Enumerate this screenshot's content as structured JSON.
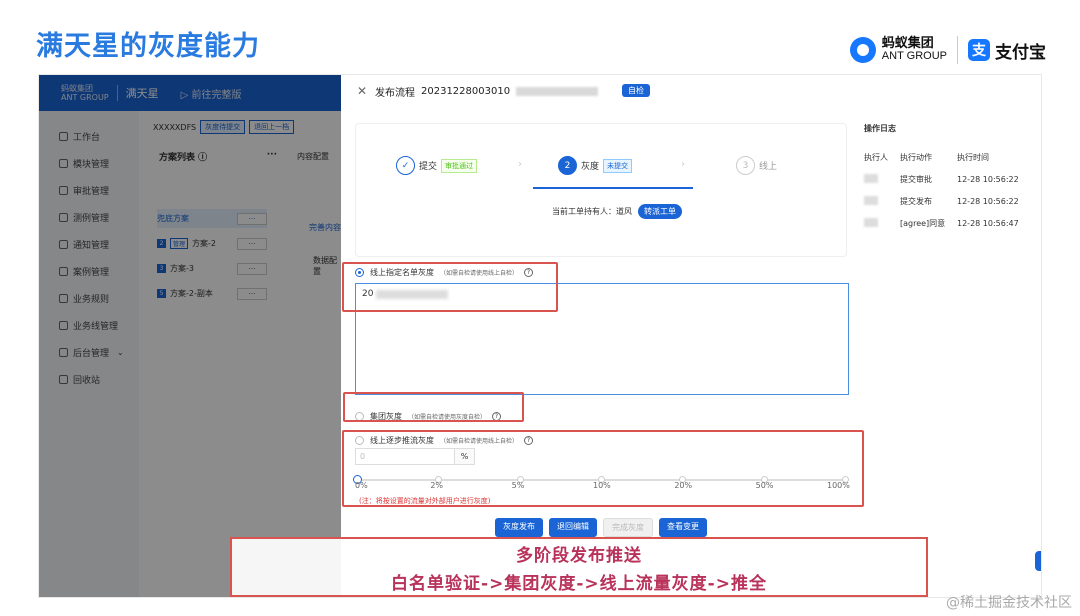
{
  "slide": {
    "title": "满天星的灰度能力",
    "logos": {
      "ant_cn": "蚂蚁集团",
      "ant_en": "ANT GROUP",
      "alipay": "支付宝",
      "alipay_mark": "支"
    }
  },
  "app": {
    "brand_cn": "蚂蚁集团",
    "brand_en": "ANT GROUP",
    "name": "满天星",
    "goto_full": "前往完整版",
    "sidebar": [
      {
        "label": "工作台",
        "icon": "home-icon"
      },
      {
        "label": "模块管理",
        "icon": "module-icon"
      },
      {
        "label": "审批管理",
        "icon": "approval-icon"
      },
      {
        "label": "测例管理",
        "icon": "test-icon"
      },
      {
        "label": "通知管理",
        "icon": "notify-icon"
      },
      {
        "label": "案例管理",
        "icon": "case-icon"
      },
      {
        "label": "业务规则",
        "icon": "rule-icon"
      },
      {
        "label": "业务线管理",
        "icon": "line-icon"
      },
      {
        "label": "后台管理",
        "icon": "admin-icon",
        "expandable": true
      },
      {
        "label": "回收站",
        "icon": "trash-icon"
      }
    ],
    "mid": {
      "code": "XXXXXDFS",
      "status_btn": "灰度待提交",
      "back_btn": "退回上一档",
      "plan_list_title": "方案列表",
      "more": "···",
      "content_config": "内容配置",
      "plans": [
        {
          "name": "兜底方案",
          "tag": "",
          "btn": "···"
        },
        {
          "name": "方案-2",
          "tag": "2",
          "prefix": "管理",
          "btn": "···"
        },
        {
          "name": "方案-3",
          "tag": "3",
          "btn": "···"
        },
        {
          "name": "方案-2-副本",
          "tag": "5",
          "btn": "···"
        }
      ],
      "link": "完善内容",
      "data_config": "数据配置"
    }
  },
  "drawer": {
    "title_prefix": "发布流程",
    "flow_id": "20231228003010",
    "badge": "自检",
    "steps": [
      {
        "num": "✓",
        "label": "提交",
        "tag": "审批通过",
        "state": "done"
      },
      {
        "num": "2",
        "label": "灰度",
        "tag": "未提交",
        "state": "active"
      },
      {
        "num": "3",
        "label": "线上",
        "tag": "",
        "state": "todo"
      }
    ],
    "holder_label": "当前工单持有人：道风",
    "holder_btn": "转派工单",
    "log": {
      "title": "操作日志",
      "headers": [
        "执行人",
        "执行动作",
        "执行时间"
      ],
      "rows": [
        {
          "action": "提交审批",
          "time": "12-28 10:56:22"
        },
        {
          "action": "提交发布",
          "time": "12-28 10:56:22"
        },
        {
          "action": "[agree]同意",
          "time": "12-28 10:56:47"
        }
      ]
    },
    "options": {
      "whitelist": {
        "label": "线上指定名单灰度",
        "hint": "（如需自检请使用线上自检）",
        "selected": true
      },
      "group": {
        "label": "集团灰度",
        "hint": "（如需自检请使用灰度自检）",
        "selected": false
      },
      "traffic": {
        "label": "线上逐步推流灰度",
        "hint": "（如需自检请使用线上自检）",
        "selected": false
      }
    },
    "textarea_value": "20",
    "percent": {
      "value": "0",
      "unit": "%",
      "marks": [
        "0%",
        "2%",
        "5%",
        "10%",
        "20%",
        "50%",
        "100%"
      ],
      "current_fraction": 0
    },
    "note": "(注：将按设置的流量对外部用户进行灰度)",
    "actions": [
      {
        "label": "灰度发布",
        "enabled": true
      },
      {
        "label": "退回编辑",
        "enabled": true
      },
      {
        "label": "完成灰度",
        "enabled": false
      },
      {
        "label": "查看变更",
        "enabled": true
      }
    ]
  },
  "banner": {
    "line1": "多阶段发布推送",
    "line2": "白名单验证->集团灰度->线上流量灰度->推全"
  },
  "watermark": "@稀土掘金技术社区",
  "colors": {
    "primary": "#1a64d6",
    "title": "#2a7be0",
    "highlight": "#d9534f",
    "banner_text": "#b8325a"
  }
}
